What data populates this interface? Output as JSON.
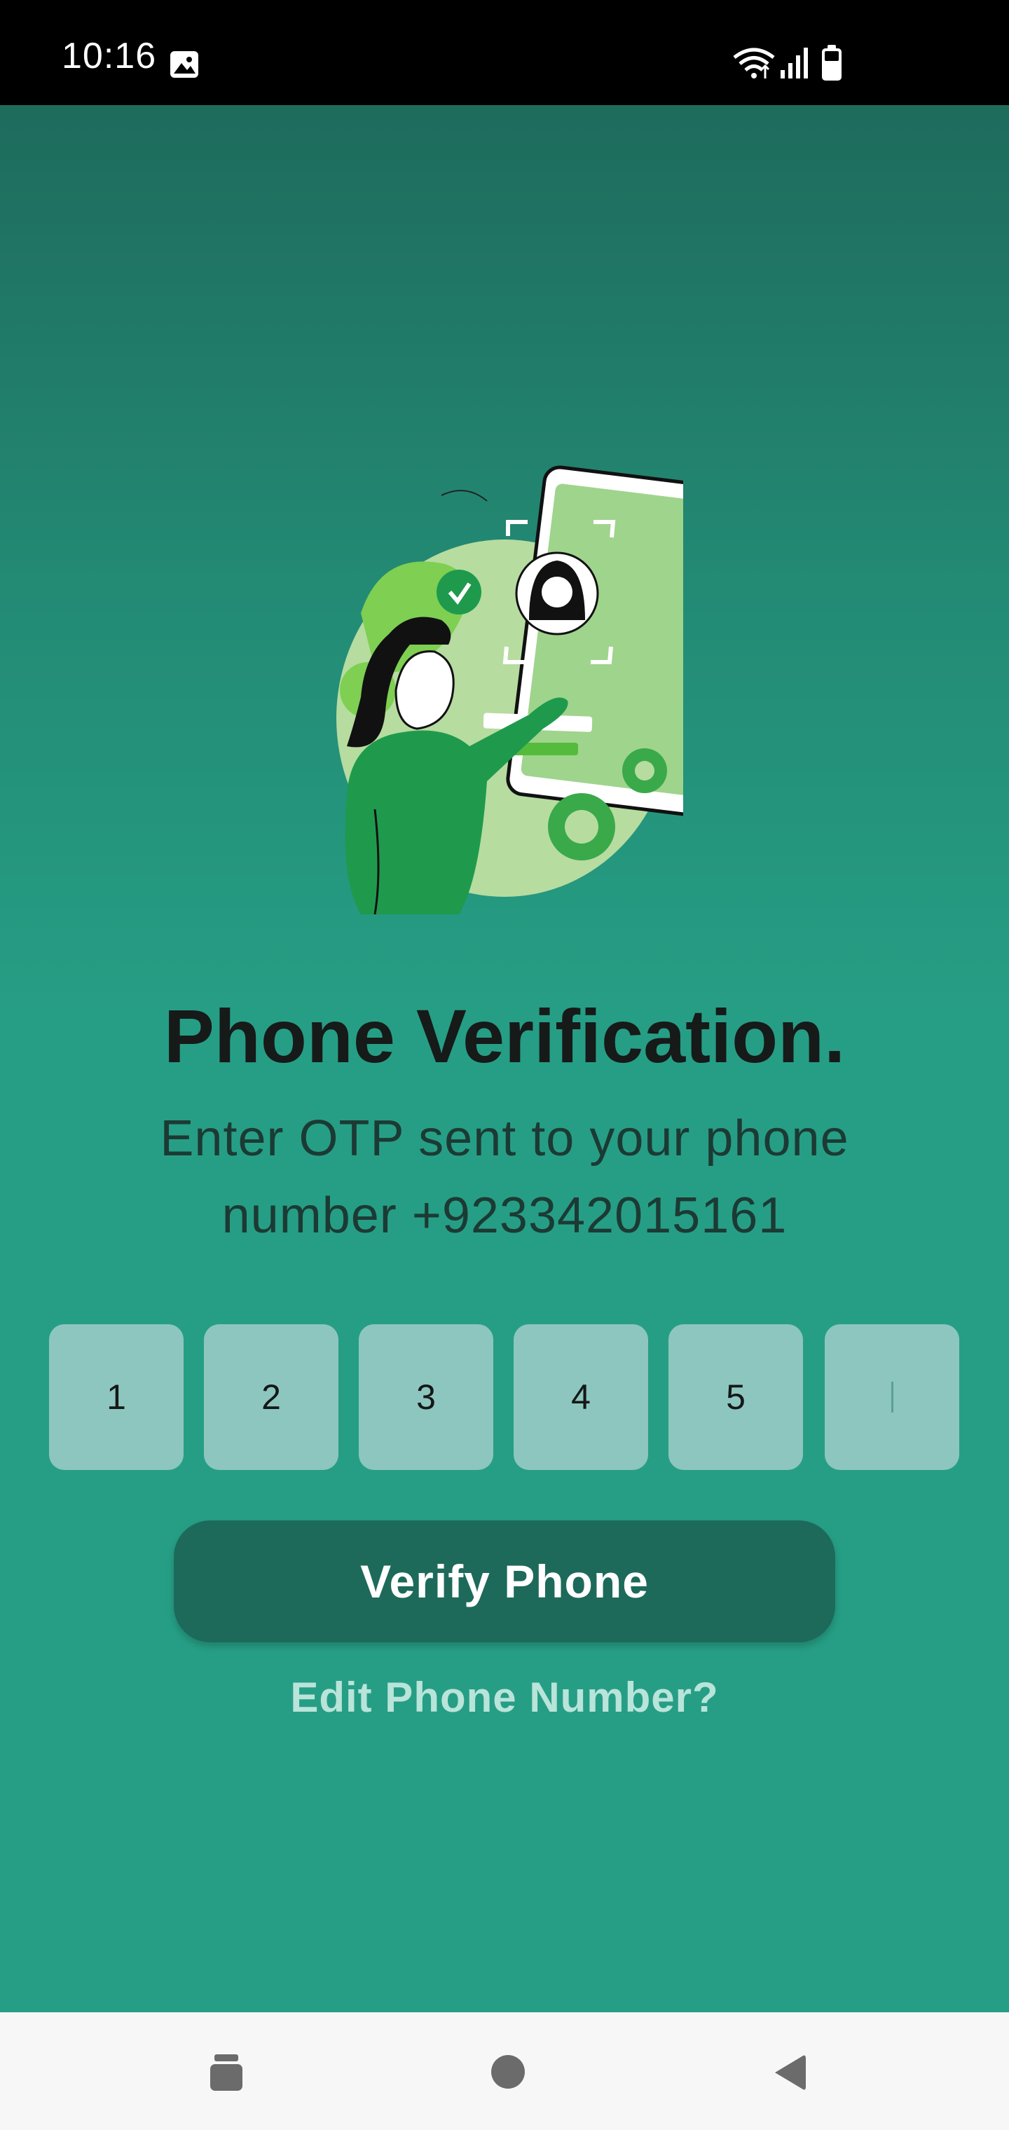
{
  "status_bar": {
    "time": "10:16",
    "icons": [
      "gallery-icon",
      "wifi-icon",
      "signal-icon",
      "battery-icon"
    ]
  },
  "illustration": {
    "icon": "phone-verification-illustration"
  },
  "title": "Phone Verification.",
  "subtitle": {
    "line1": "Enter OTP sent to your phone",
    "line2": "number +923342015161"
  },
  "otp": {
    "digits": [
      "1",
      "2",
      "3",
      "4",
      "5",
      ""
    ]
  },
  "verify_button": {
    "label": "Verify Phone"
  },
  "edit_link": {
    "label": "Edit Phone Number?"
  },
  "nav_bar": {
    "icons": [
      "recents-icon",
      "home-icon",
      "back-icon"
    ]
  },
  "colors": {
    "background_top": "#1e6b5c",
    "background_bottom": "#269e85",
    "button": "#1d6a5a",
    "otp_box": "#8dc6bf",
    "link": "#b9e4da"
  }
}
